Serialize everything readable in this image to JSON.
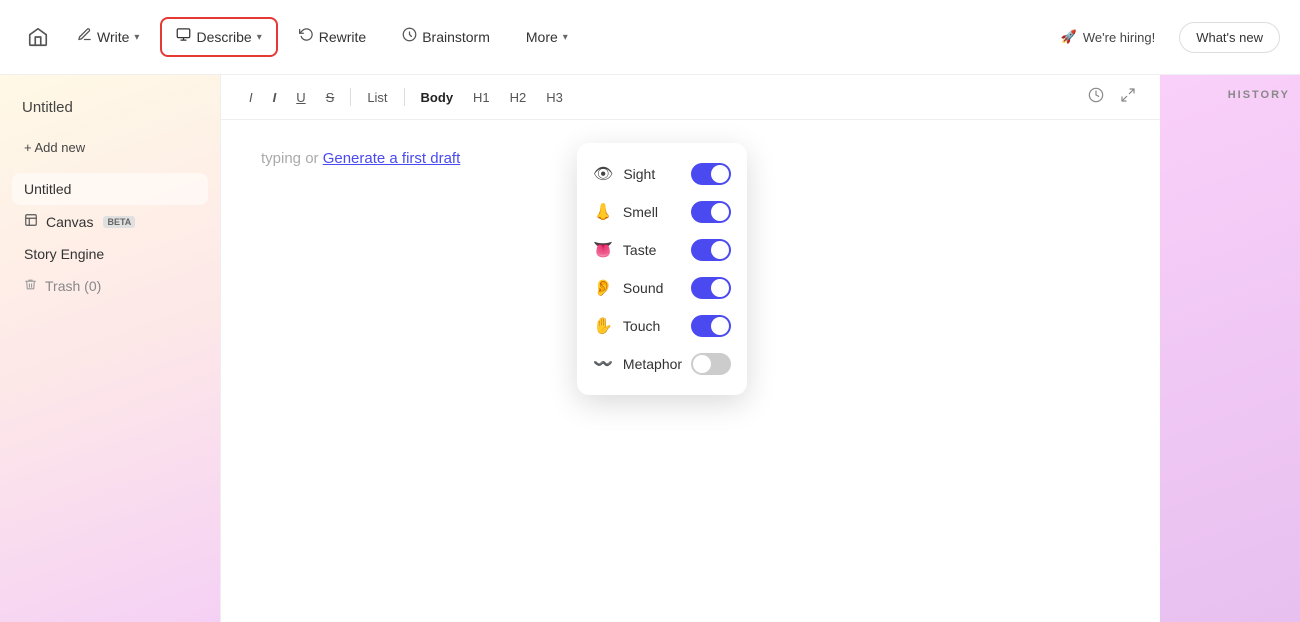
{
  "topbar": {
    "home_icon": "🏠",
    "buttons": [
      {
        "id": "write",
        "label": "Write",
        "icon": "✏️",
        "has_chevron": true,
        "active": false
      },
      {
        "id": "describe",
        "label": "Describe",
        "icon": "🖼",
        "has_chevron": true,
        "active": true
      },
      {
        "id": "rewrite",
        "label": "Rewrite",
        "icon": "🔄",
        "has_chevron": false,
        "active": false
      },
      {
        "id": "brainstorm",
        "label": "Brainstorm",
        "icon": "💡",
        "has_chevron": false,
        "active": false
      },
      {
        "id": "more",
        "label": "More",
        "icon": "",
        "has_chevron": true,
        "active": false
      }
    ],
    "hiring_label": "We're hiring!",
    "whats_new_label": "What's new"
  },
  "sidebar": {
    "title": "Untitled",
    "add_new_label": "+ Add new",
    "items": [
      {
        "id": "untitled",
        "label": "Untitled",
        "icon": "",
        "active": true
      },
      {
        "id": "canvas",
        "label": "Canvas",
        "icon": "🖼",
        "badge": "BETA",
        "active": false
      },
      {
        "id": "story-engine",
        "label": "Story Engine",
        "icon": "",
        "active": false
      },
      {
        "id": "trash",
        "label": "Trash (0)",
        "icon": "🗑",
        "active": false
      }
    ]
  },
  "editor": {
    "toolbar": {
      "italic": "I",
      "bold_italic": "I",
      "underline": "U",
      "strikethrough": "S",
      "list": "List",
      "body": "Body",
      "h1": "H1",
      "h2": "H2",
      "h3": "H3"
    },
    "placeholder": "typing or Generate a first draft",
    "generate_link_text": "Generate a first draft"
  },
  "dropdown": {
    "items": [
      {
        "id": "sight",
        "label": "Sight",
        "icon": "👁",
        "enabled": true
      },
      {
        "id": "smell",
        "label": "Smell",
        "icon": "👃",
        "enabled": true
      },
      {
        "id": "taste",
        "label": "Taste",
        "icon": "👅",
        "enabled": true
      },
      {
        "id": "sound",
        "label": "Sound",
        "icon": "👂",
        "enabled": true
      },
      {
        "id": "touch",
        "label": "Touch",
        "icon": "✋",
        "enabled": true
      },
      {
        "id": "metaphor",
        "label": "Metaphor",
        "icon": "〰",
        "enabled": false
      }
    ]
  },
  "right_panel": {
    "history_label": "HISTORY"
  }
}
